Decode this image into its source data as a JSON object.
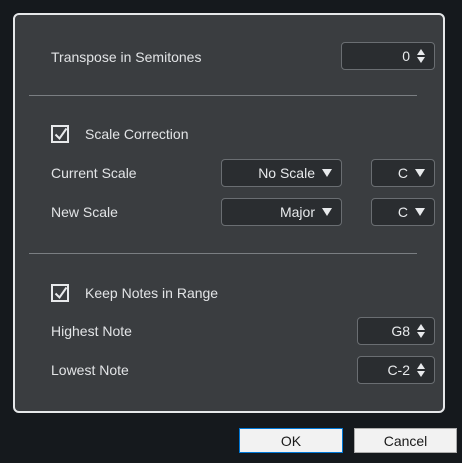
{
  "transpose": {
    "label": "Transpose in Semitones",
    "value": "0"
  },
  "scale_correction": {
    "checkbox_label": "Scale Correction",
    "checked": true,
    "current_scale": {
      "label": "Current Scale",
      "scale": "No Scale",
      "root": "C"
    },
    "new_scale": {
      "label": "New Scale",
      "scale": "Major",
      "root": "C"
    }
  },
  "keep_notes": {
    "checkbox_label": "Keep Notes in Range",
    "checked": true,
    "highest": {
      "label": "Highest Note",
      "value": "G8"
    },
    "lowest": {
      "label": "Lowest Note",
      "value": "C-2"
    }
  },
  "buttons": {
    "ok": "OK",
    "cancel": "Cancel"
  }
}
